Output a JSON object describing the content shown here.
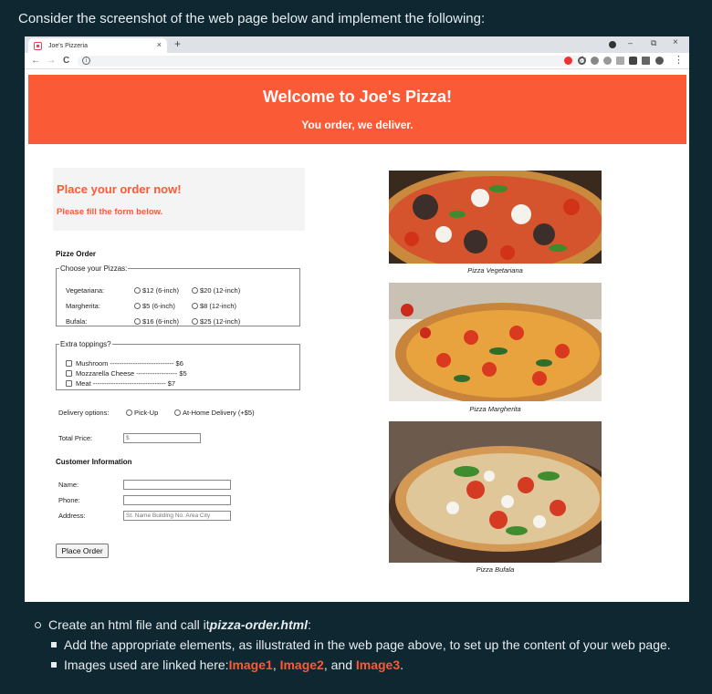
{
  "intro": "Consider the screenshot of the web page below and implement the following:",
  "browser": {
    "tab_title": "Joe's Pizzeria",
    "tab_close": "×",
    "new_tab": "+",
    "minimize": "–",
    "maximize": "⧉",
    "close": "×",
    "back": "←",
    "forward": "→",
    "reload": "C",
    "info": "i",
    "star": "☆",
    "menu": "⋮"
  },
  "page": {
    "banner_title": "Welcome to Joe's Pizza!",
    "banner_subtitle": "You order, we deliver.",
    "callout_title": "Place your order now!",
    "callout_sub": "Please fill the form below.",
    "order_heading": "Pizze Order",
    "pizzas_legend": "Choose your Pizzas:",
    "pizzas": [
      {
        "name": "Vegetariana:",
        "opt1": "$12 (6-inch)",
        "opt2": "$20 (12-inch)"
      },
      {
        "name": "Margherita:",
        "opt1": "$5 (6-inch)",
        "opt2": "$8 (12-inch)"
      },
      {
        "name": "Bufala:",
        "opt1": "$16 (6-inch)",
        "opt2": "$25 (12-inch)"
      }
    ],
    "toppings_legend": "Extra toppings?",
    "toppings": [
      {
        "label": "Mushroom ---------------------------- $6"
      },
      {
        "label": "Mozzarella Cheese ------------------ $5"
      },
      {
        "label": "Meat -------------------------------- $7"
      }
    ],
    "delivery_label": "Delivery options:",
    "delivery_pickup": "Pick-Up",
    "delivery_home": "At-Home Delivery (+$5)",
    "total_label": "Total Price:",
    "total_value": "$",
    "customer_heading": "Customer Information",
    "name_label": "Name:",
    "phone_label": "Phone:",
    "address_label": "Address:",
    "address_placeholder": "St. Name Building No. Area City",
    "order_button": "Place Order",
    "captions": [
      "Pizza Vegetariana",
      "Pizza Margherita",
      "Pizza Bufala"
    ]
  },
  "bullets": {
    "line1_prefix": "Create an html file and call it ",
    "line1_file": "pizza-order.html",
    "line1_suffix": ":",
    "line2": "Add the appropriate elements, as illustrated in the web page above, to set up the content of your web page.",
    "line3_prefix": "Images used are linked here: ",
    "link1": "Image1",
    "sep1": ", ",
    "link2": "Image2",
    "sep2": ", and ",
    "link3": "Image3",
    "end": "."
  },
  "colors": {
    "accent": "#fb5a36",
    "background": "#0f2731"
  }
}
